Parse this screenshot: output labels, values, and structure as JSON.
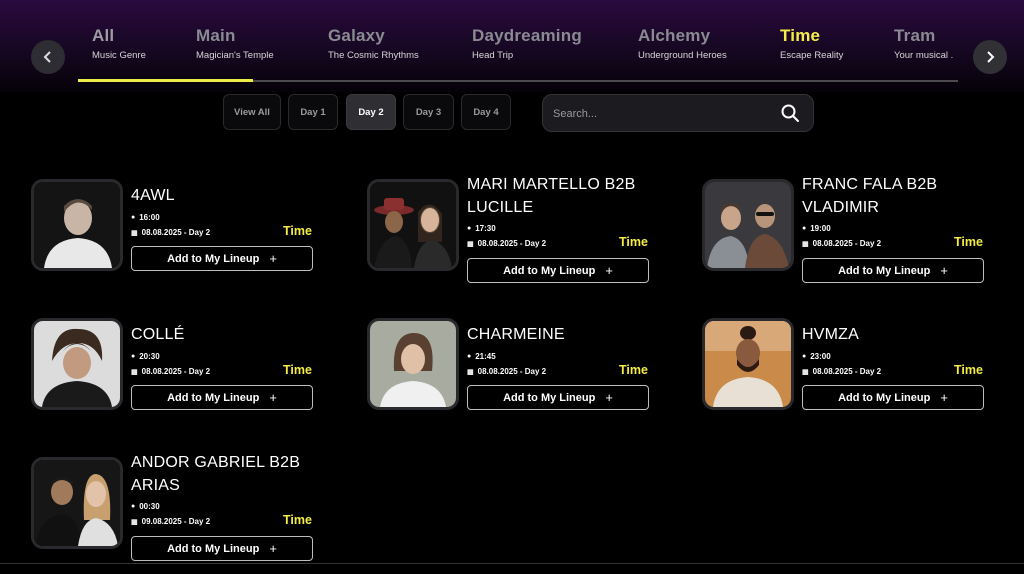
{
  "nav": {
    "prev_icon": "chevron-left-icon",
    "next_icon": "chevron-right-icon"
  },
  "tabs": [
    {
      "title": "All",
      "subtitle": "Music Genre"
    },
    {
      "title": "Main",
      "subtitle": "Magician's Temple"
    },
    {
      "title": "Galaxy",
      "subtitle": "The Cosmic Rhythms"
    },
    {
      "title": "Daydreaming",
      "subtitle": "Head Trip"
    },
    {
      "title": "Alchemy",
      "subtitle": "Underground Heroes"
    },
    {
      "title": "Time",
      "subtitle": "Escape Reality"
    },
    {
      "title": "Tram",
      "subtitle": "Your musical ."
    }
  ],
  "days": {
    "view_all": "View All",
    "day1": "Day 1",
    "day2": "Day 2",
    "day3": "Day 3",
    "day4": "Day 4",
    "selected": "Day 2"
  },
  "search": {
    "placeholder": "Search...",
    "value": ""
  },
  "artists": [
    {
      "name": "4AWL",
      "time": "16:00",
      "date": "08.08.2025 - Day 2",
      "stage": "Time",
      "button": "Add to My Lineup"
    },
    {
      "name": "MARI MARTELLO B2B LUCILLE",
      "time": "17:30",
      "date": "08.08.2025 - Day 2",
      "stage": "Time",
      "button": "Add to My Lineup"
    },
    {
      "name": "FRANC FALA B2B VLADIMIR",
      "time": "19:00",
      "date": "08.08.2025 - Day 2",
      "stage": "Time",
      "button": "Add to My Lineup"
    },
    {
      "name": "COLLÉ",
      "time": "20:30",
      "date": "08.08.2025 - Day 2",
      "stage": "Time",
      "button": "Add to My Lineup"
    },
    {
      "name": "CHARMEINE",
      "time": "21:45",
      "date": "08.08.2025 - Day 2",
      "stage": "Time",
      "button": "Add to My Lineup"
    },
    {
      "name": "HVMZA",
      "time": "23:00",
      "date": "08.08.2025 - Day 2",
      "stage": "Time",
      "button": "Add to My Lineup"
    },
    {
      "name": "ANDOR GABRIEL B2B ARIAS",
      "time": "00:30",
      "date": "09.08.2025 - Day 2",
      "stage": "Time",
      "button": "Add to My Lineup"
    }
  ],
  "colors": {
    "accent": "#f2ec44",
    "header_gradient_top": "#2a0a3e",
    "background": "#000000"
  }
}
